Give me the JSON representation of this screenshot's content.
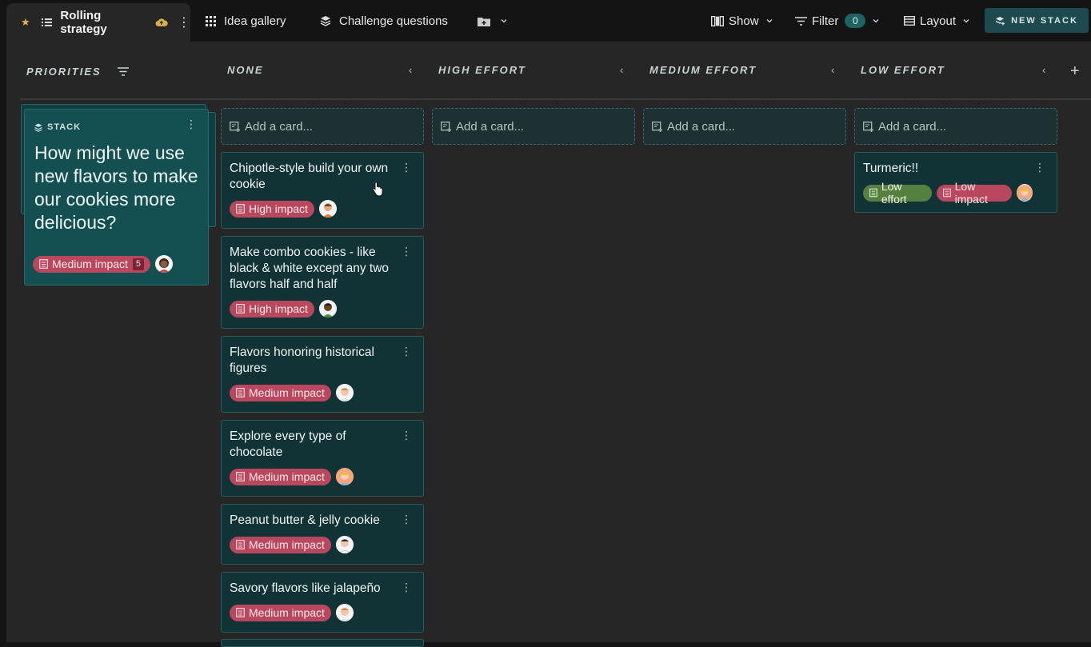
{
  "topbar": {
    "active_tab": "Rolling strategy",
    "tabs": [
      "Idea gallery",
      "Challenge questions"
    ],
    "show_label": "Show",
    "filter_label": "Filter",
    "filter_count": "0",
    "layout_label": "Layout",
    "new_stack_label": "NEW STACK"
  },
  "board": {
    "rows_header": "PRIORITIES",
    "columns": [
      "NONE",
      "HIGH EFFORT",
      "MEDIUM EFFORT",
      "LOW EFFORT"
    ],
    "add_card_label": "Add a card...",
    "stack": {
      "label": "STACK",
      "title": "How might we use new flavors to make our cookies more delicious?",
      "tag": "Medium impact",
      "count": "5"
    },
    "none_cards": [
      {
        "title": "Chipotle-style build your own cookie",
        "tag": "High impact"
      },
      {
        "title": "Make combo cookies - like black & white except any two flavors half and half",
        "tag": "High impact"
      },
      {
        "title": "Flavors honoring historical figures",
        "tag": "Medium impact"
      },
      {
        "title": "Explore every type of chocolate",
        "tag": "Medium impact"
      },
      {
        "title": "Peanut butter & jelly cookie",
        "tag": "Medium impact"
      },
      {
        "title": "Savory flavors like jalapeño",
        "tag": "Medium impact"
      }
    ],
    "low_effort_cards": [
      {
        "title": "Turmeric!!",
        "tags": [
          "Low effort",
          "Low impact"
        ]
      }
    ]
  },
  "colors": {
    "accent": "#1f6264",
    "card_bg": "#113336",
    "impact_tag": "#b9475e",
    "effort_tag": "#56803f",
    "star": "#e0b54a"
  }
}
